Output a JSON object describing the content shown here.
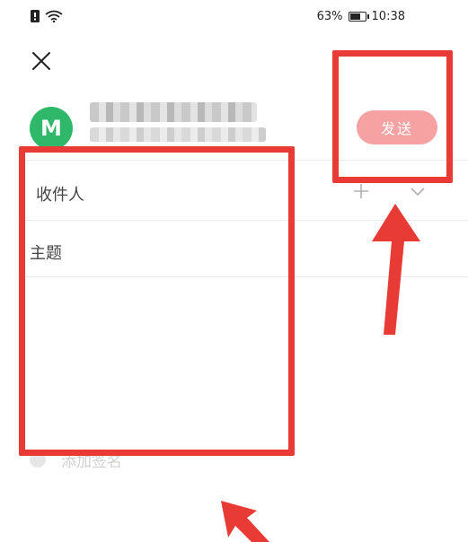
{
  "status_bar": {
    "battery_percent": "63%",
    "battery_level": 0.63,
    "time": "10:38"
  },
  "compose": {
    "sender_initial": "M",
    "send_label": "发送",
    "recipient_label": "收件人",
    "subject_label": "主题",
    "attachment_label": "添加签名"
  },
  "colors": {
    "avatar": "#2fb86a",
    "send_button": "#f7a2a2",
    "annotation": "#e83b35"
  },
  "icons": [
    "sim-icon",
    "wifi-icon",
    "battery-icon",
    "close-icon",
    "plus-icon",
    "chevron-down-icon",
    "arrow-icon"
  ]
}
